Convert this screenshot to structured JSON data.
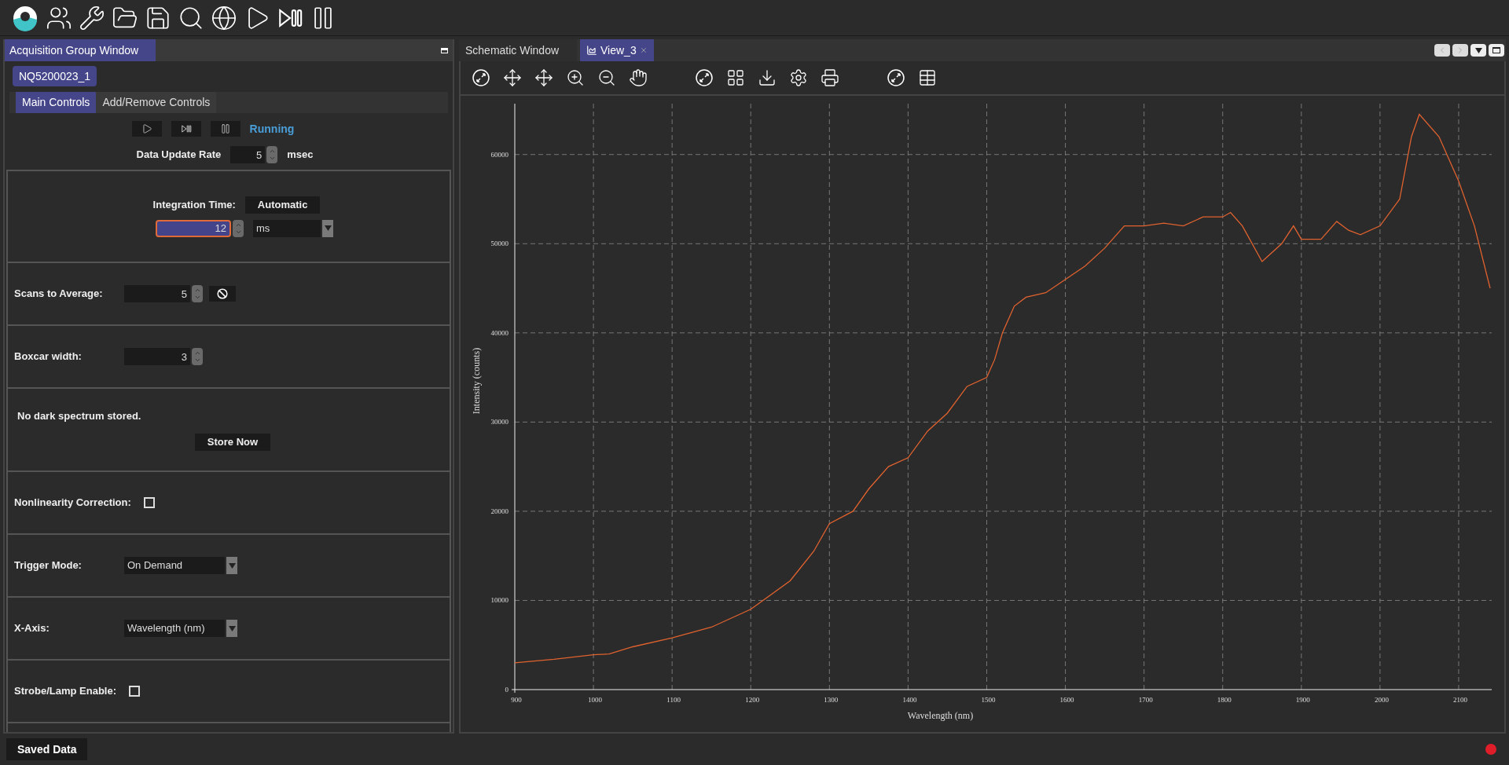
{
  "acquisition_window": {
    "title": "Acquisition Group Window",
    "device_tabs": [
      {
        "label": "NQ5200023_1",
        "selected": true
      }
    ],
    "tabs": [
      {
        "label": "Main Controls",
        "selected": true
      },
      {
        "label": "Add/Remove Controls",
        "selected": false
      }
    ],
    "run_status": "Running",
    "data_update_rate": {
      "label": "Data Update Rate",
      "value": "5",
      "unit": "msec"
    },
    "sections": [
      {
        "kind": "integration",
        "label": "Integration Time:",
        "mode_button": "Automatic",
        "value": "12",
        "unit": "ms"
      },
      {
        "kind": "spinner",
        "label": "Scans to Average:",
        "value": "5",
        "reset_button": true
      },
      {
        "kind": "spinner",
        "label": "Boxcar width:",
        "value": "3",
        "reset_button": false
      },
      {
        "kind": "dark",
        "message": "No dark spectrum stored.",
        "button": "Store Now"
      },
      {
        "kind": "checkbox",
        "label": "Nonlinearity Correction:",
        "checked": false
      },
      {
        "kind": "dropdown",
        "label": "Trigger Mode:",
        "value": "On Demand"
      },
      {
        "kind": "dropdown",
        "label": "X-Axis:",
        "value": "Wavelength (nm)"
      },
      {
        "kind": "checkbox",
        "label": "Strobe/Lamp Enable:",
        "checked": false
      }
    ]
  },
  "view_tabs": [
    {
      "label": "Schematic Window",
      "selected": false,
      "kind": "plain"
    },
    {
      "label": "View_3",
      "selected": true,
      "kind": "graph"
    }
  ],
  "chart": {
    "chart_data": {
      "type": "line",
      "xlabel": "Wavelength (nm)",
      "ylabel": "Intensity (counts)",
      "xlim": [
        900,
        2142
      ],
      "ylim": [
        0,
        65700
      ],
      "xticks": [
        900,
        1000,
        1100,
        1200,
        1300,
        1400,
        1500,
        1600,
        1700,
        1800,
        1900,
        2000,
        2100
      ],
      "yticks": [
        0,
        10000,
        20000,
        30000,
        40000,
        50000,
        60000
      ],
      "x": [
        900,
        950,
        1000,
        1020,
        1050,
        1100,
        1150,
        1200,
        1250,
        1280,
        1300,
        1330,
        1350,
        1375,
        1400,
        1425,
        1450,
        1475,
        1500,
        1510,
        1520,
        1535,
        1550,
        1575,
        1600,
        1625,
        1650,
        1675,
        1700,
        1725,
        1750,
        1775,
        1800,
        1810,
        1825,
        1850,
        1875,
        1890,
        1900,
        1925,
        1945,
        1960,
        1975,
        2000,
        2025,
        2040,
        2050,
        2075,
        2100,
        2120,
        2140
      ],
      "grid": true,
      "series": [
        {
          "color": "#e0622f",
          "values": [
            3000,
            3400,
            3900,
            4000,
            4800,
            5800,
            7000,
            9000,
            12200,
            15500,
            18600,
            20000,
            22500,
            25000,
            26000,
            29000,
            31000,
            34000,
            35000,
            37000,
            40000,
            43000,
            44000,
            44500,
            46000,
            47500,
            49500,
            52000,
            52000,
            52300,
            52000,
            53000,
            53000,
            53500,
            52000,
            48000,
            50000,
            52000,
            50500,
            50500,
            52500,
            51500,
            51000,
            52000,
            55000,
            62000,
            64500,
            62000,
            57000,
            52000,
            45000
          ]
        }
      ]
    }
  },
  "status_bar": {
    "button": "Saved Data"
  }
}
